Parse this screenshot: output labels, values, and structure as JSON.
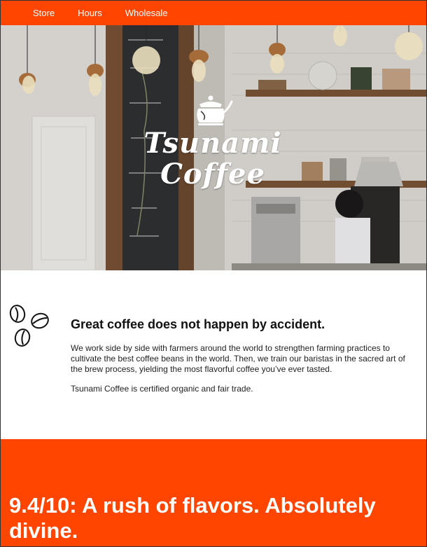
{
  "nav": {
    "items": [
      {
        "label": "Store"
      },
      {
        "label": "Hours"
      },
      {
        "label": "Wholesale"
      }
    ]
  },
  "hero": {
    "logo_text": "Tsunami Coffee",
    "icon": "kettle-icon"
  },
  "intro": {
    "icon": "coffee-beans-icon",
    "headline": "Great coffee does not happen by accident.",
    "paragraph1": "We work side by side with farmers around the world to strengthen farming practices to cultivate the best coffee beans in the world. Then, we train our baristas in the sacred art of the brew process, yielding the most flavorful coffee you’ve ever tasted.",
    "paragraph2": "Tsunami Coffee is certified organic and fair trade."
  },
  "review": {
    "text": "9.4/10: A rush of flavors. Absolutely divine."
  },
  "colors": {
    "brand": "#ff4500",
    "text": "#111111",
    "background": "#ffffff"
  }
}
